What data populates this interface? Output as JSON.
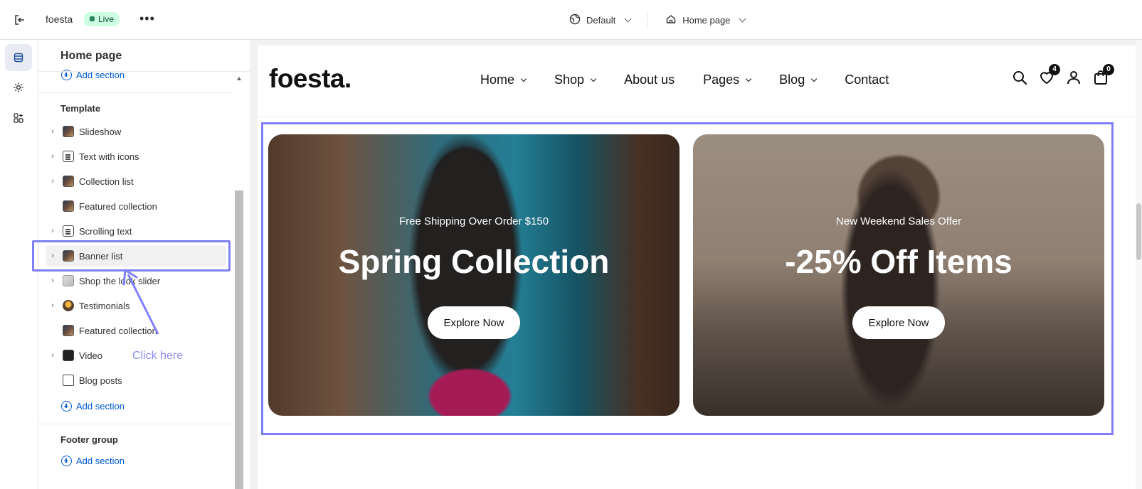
{
  "topbar": {
    "store_name": "foesta",
    "status_badge": "Live",
    "theme_selector": "Default",
    "page_selector": "Home page"
  },
  "sidebar": {
    "title": "Home page",
    "top_add_section": "Add section",
    "template_label": "Template",
    "items": [
      {
        "label": "Slideshow",
        "icon": "image-icon",
        "expandable": true
      },
      {
        "label": "Text with icons",
        "icon": "text-block-icon",
        "expandable": true
      },
      {
        "label": "Collection list",
        "icon": "image-icon",
        "expandable": true
      },
      {
        "label": "Featured collection",
        "icon": "image-icon",
        "expandable": false
      },
      {
        "label": "Scrolling text",
        "icon": "text-block-icon",
        "expandable": true
      },
      {
        "label": "Banner list",
        "icon": "image-icon",
        "expandable": true,
        "selected": true
      },
      {
        "label": "Shop the look slider",
        "icon": "image-icon",
        "expandable": true
      },
      {
        "label": "Testimonials",
        "icon": "avatar-icon",
        "expandable": true
      },
      {
        "label": "Featured collection",
        "icon": "image-icon",
        "expandable": false
      },
      {
        "label": "Video",
        "icon": "video-icon",
        "expandable": true
      },
      {
        "label": "Blog posts",
        "icon": "blog-icon",
        "expandable": false
      }
    ],
    "template_add_section": "Add section",
    "footer_group_label": "Footer group",
    "footer_add_section": "Add section"
  },
  "annotation": {
    "label": "Click here",
    "color": "#7f7ff7"
  },
  "preview": {
    "logo": "foesta.",
    "nav": [
      {
        "label": "Home",
        "dropdown": true
      },
      {
        "label": "Shop",
        "dropdown": true
      },
      {
        "label": "About us",
        "dropdown": false
      },
      {
        "label": "Pages",
        "dropdown": true
      },
      {
        "label": "Blog",
        "dropdown": true
      },
      {
        "label": "Contact",
        "dropdown": false
      }
    ],
    "wishlist_count": "4",
    "cart_count": "0",
    "banners": [
      {
        "subtitle": "Free Shipping Over Order $150",
        "heading": "Spring Collection",
        "button": "Explore Now"
      },
      {
        "subtitle": "New Weekend Sales Offer",
        "heading": "-25% Off Items",
        "button": "Explore Now"
      }
    ]
  },
  "colors": {
    "accent": "#7f7ff7",
    "link": "#005bd3",
    "live_badge_bg": "#cdfee1"
  }
}
